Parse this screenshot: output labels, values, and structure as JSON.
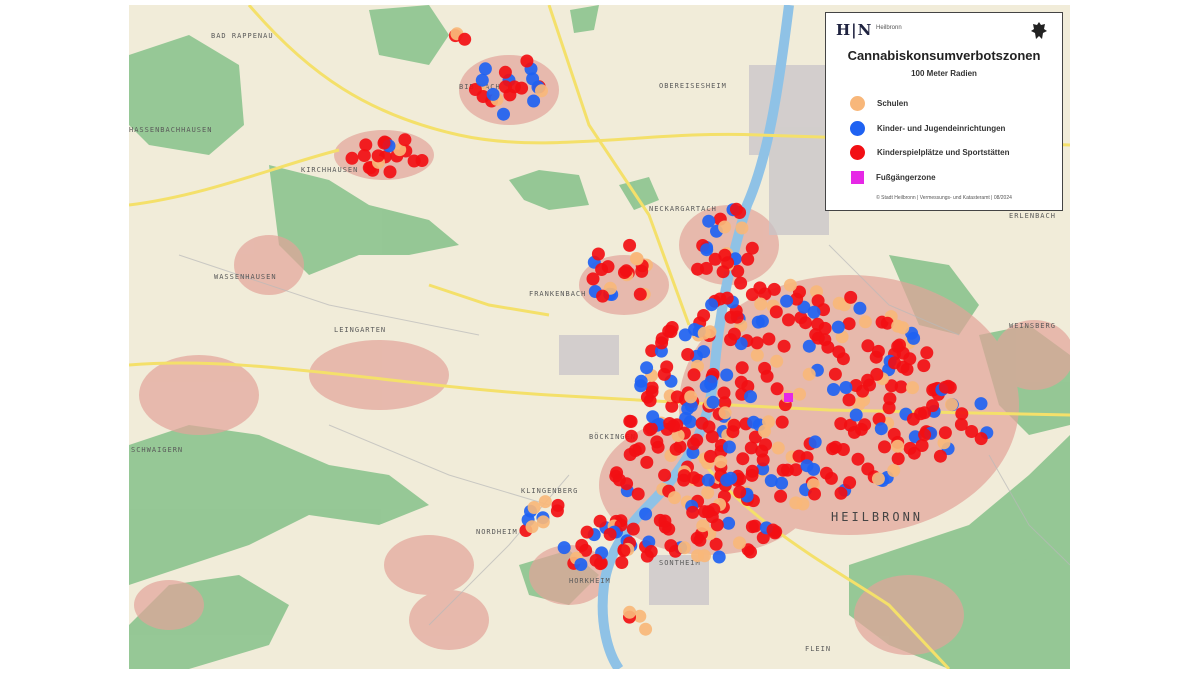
{
  "legend": {
    "logo_text": "H|N",
    "logo_subtext": "Heilbronn",
    "title": "Cannabiskonsumverbotszonen",
    "subtitle": "100 Meter Radien",
    "items": [
      {
        "label": "Schulen",
        "color": "#f8b77a",
        "shape": "circle"
      },
      {
        "label": "Kinder- und Jugendeinrichtungen",
        "color": "#1f62f2",
        "shape": "circle"
      },
      {
        "label": "Kinderspielplätze und Sportstätten",
        "color": "#f20f14",
        "shape": "circle"
      },
      {
        "label": "Fußgängerzone",
        "color": "#e628e6",
        "shape": "square"
      }
    ],
    "copyright": "© Stadt Heilbronn | Vermessungs- und Katasteramt | 08/2024"
  },
  "places": [
    {
      "name": "BAD RAPPENAU",
      "size": "small"
    },
    {
      "name": "BIBERACH",
      "size": "small"
    },
    {
      "name": "OBEREISESHEIM",
      "size": "small"
    },
    {
      "name": "HASSENBACHHAUSEN",
      "size": "small"
    },
    {
      "name": "KIRCHHAUSEN",
      "size": "small"
    },
    {
      "name": "NECKARGARTACH",
      "size": "small"
    },
    {
      "name": "WASSENHAUSEN",
      "size": "small"
    },
    {
      "name": "FRANKENBACH",
      "size": "small"
    },
    {
      "name": "LEINGARTEN",
      "size": "small"
    },
    {
      "name": "BÖCKINGEN",
      "size": "small"
    },
    {
      "name": "SCHWAIGERN",
      "size": "small"
    },
    {
      "name": "KLINGENBERG",
      "size": "small"
    },
    {
      "name": "NORDHEIM",
      "size": "small"
    },
    {
      "name": "HORKHEIM",
      "size": "small"
    },
    {
      "name": "SONTHEIM",
      "size": "small"
    },
    {
      "name": "WEINSBERG",
      "size": "small"
    },
    {
      "name": "ERLENBACH",
      "size": "small"
    },
    {
      "name": "FLEIN",
      "size": "small"
    },
    {
      "name": "HEILBRONN",
      "size": "big"
    }
  ]
}
